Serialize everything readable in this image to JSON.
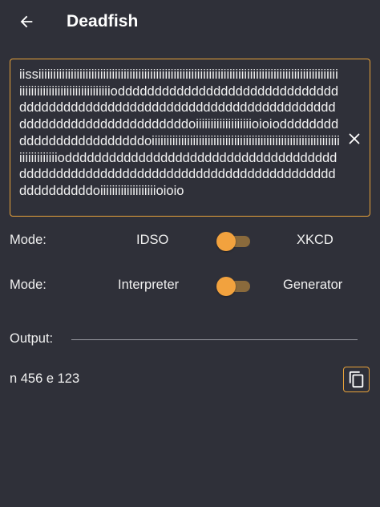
{
  "app_bar": {
    "title": "Deadfish",
    "back_icon": "arrow-back-icon"
  },
  "code_input": {
    "value": "iissiiiiiiiiiiiiiiiiiiiiiiiiiiiiiiiiiiiiiiiiiiiiiiiiiiiiiiiiiiiiiiiiiiiiiiiiiiiiiiiiiiiiiiiiiiiiiiiiiiiiiiiiiiiiiiiiiiiiiiiiiiiiiiiiiiiiioddddddddddddddddddddddddddddddddddddddddddddddddddddddddddddddddddddddddddddddddddddddddddddddddoiiiiiiiiiiiiiiiiiiioioiodddddddddddddddddddddddddoiiiiiiiiiiiiiiiiiiiiiiiiiiiiiiiiiiiiiiiiiiiiiiiiiiiiiiiiiiiiiiiiiiiiiiiiiiiiioddddddddddddddddddddddddddddddddddddddddddddddddddddddddddddddddddddddddddddddddddddddddddoiiiiiiiiiiiiiiiiiiioioio",
    "clear_icon": "close-icon"
  },
  "mode_1": {
    "label": "Mode:",
    "left_option": "IDSO",
    "right_option": "XKCD",
    "switch_on": false
  },
  "mode_2": {
    "label": "Mode:",
    "left_option": "Interpreter",
    "right_option": "Generator",
    "switch_on": false
  },
  "output": {
    "label": "Output:",
    "value": "n 456 e 123",
    "copy_icon": "copy-icon"
  },
  "colors": {
    "background": "#2f3039",
    "accent": "#f2a23e",
    "track": "#8a6a3c",
    "text": "#f0f0f0"
  }
}
